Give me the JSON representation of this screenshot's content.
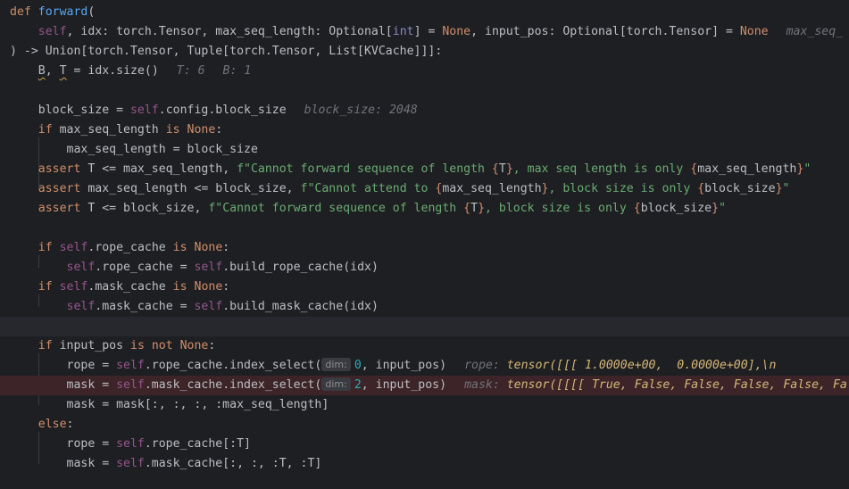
{
  "editor": {
    "lines": [
      {
        "text": "def forward("
      },
      {
        "text": "    self, idx: torch.Tensor, max_seq_length: Optional[int] = None, input_pos: Optional[torch.Tensor] = None",
        "hint": "max_seq_"
      },
      {
        "text": ") -> Union[torch.Tensor, Tuple[torch.Tensor, List[KVCache]]]:"
      },
      {
        "text": "    B, T = idx.size()",
        "hint_t": "T: 6",
        "hint_b": "B: 1"
      },
      {
        "text": ""
      },
      {
        "text": "    block_size = self.config.block_size",
        "hint": "block_size: 2048"
      },
      {
        "text": "    if max_seq_length is None:"
      },
      {
        "text": "        max_seq_length = block_size"
      },
      {
        "text": "    assert T <= max_seq_length, f\"Cannot forward sequence of length {T}, max seq length is only {max_seq_length}\""
      },
      {
        "text": "    assert max_seq_length <= block_size, f\"Cannot attend to {max_seq_length}, block size is only {block_size}\""
      },
      {
        "text": "    assert T <= block_size, f\"Cannot forward sequence of length {T}, block size is only {block_size}\""
      },
      {
        "text": ""
      },
      {
        "text": "    if self.rope_cache is None:"
      },
      {
        "text": "        self.rope_cache = self.build_rope_cache(idx)"
      },
      {
        "text": "    if self.mask_cache is None:"
      },
      {
        "text": "        self.mask_cache = self.build_mask_cache(idx)"
      },
      {
        "text": ""
      },
      {
        "text": "    if input_pos is not None:"
      },
      {
        "text": "        rope = self.rope_cache.index_select(dim: 0, input_pos)",
        "param_hint": "dim:",
        "debug_name": "rope:",
        "debug_value": "tensor([[[ 1.0000e+00,  0.0000e+00],\\n"
      },
      {
        "text": "        mask = self.mask_cache.index_select(dim: 2, input_pos)",
        "param_hint": "dim:",
        "debug_name": "mask:",
        "debug_value": "tensor([[[[ True, False, False, False, False, Fa"
      },
      {
        "text": "        mask = mask[:, :, :, :max_seq_length]"
      },
      {
        "text": "    else:"
      },
      {
        "text": "        rope = self.rope_cache[:T]"
      },
      {
        "text": "        mask = self.mask_cache[:, :, :T, :T]"
      }
    ]
  },
  "colors": {
    "background": "#1e1f22",
    "keyword": "#cf8e6d",
    "function": "#56a8f5",
    "self": "#94558d",
    "string": "#6aab73",
    "number": "#2aacb8",
    "debug_value": "#d5b778",
    "breakpoint_line": "#3d2428",
    "caret_line": "#26282e"
  }
}
